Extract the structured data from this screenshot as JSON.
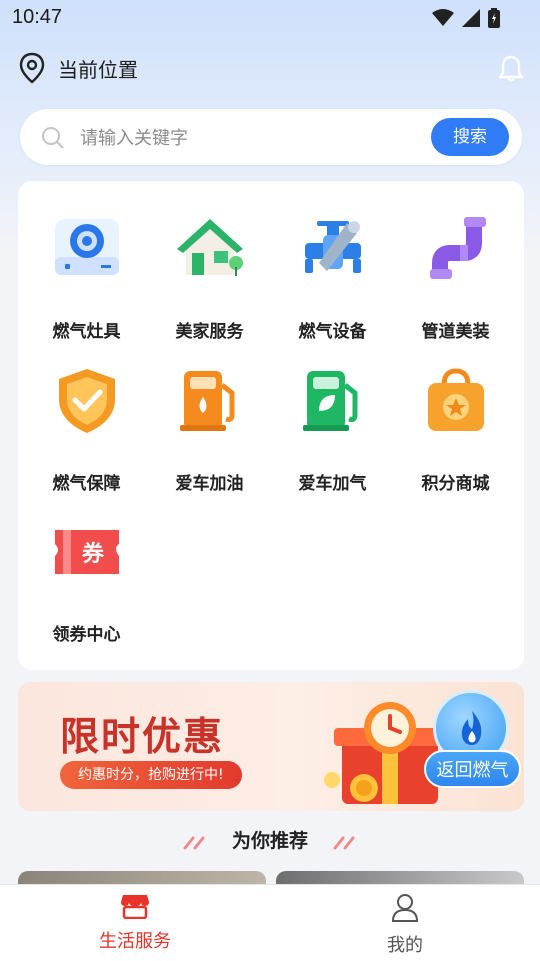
{
  "status_bar": {
    "time": "10:47"
  },
  "header": {
    "location_label": "当前位置"
  },
  "search": {
    "placeholder": "请输入关键字",
    "button_label": "搜索"
  },
  "services": [
    {
      "label": "燃气灶具",
      "icon": "gas-stove-icon"
    },
    {
      "label": "美家服务",
      "icon": "house-icon"
    },
    {
      "label": "燃气设备",
      "icon": "gas-valve-tools-icon"
    },
    {
      "label": "管道美装",
      "icon": "pipe-icon"
    },
    {
      "label": "燃气保障",
      "icon": "shield-check-icon"
    },
    {
      "label": "爱车加油",
      "icon": "fuel-pump-icon"
    },
    {
      "label": "爱车加气",
      "icon": "gas-pump-leaf-icon"
    },
    {
      "label": "积分商城",
      "icon": "shopping-bag-star-icon"
    },
    {
      "label": "领券中心",
      "icon": "coupon-icon"
    }
  ],
  "coupon_icon_text": "券",
  "banner": {
    "title": "限时优惠",
    "subtitle": "约惠时分，抢购进行中!"
  },
  "floating_button": {
    "label": "返回燃气"
  },
  "recommend": {
    "title": "为你推荐"
  },
  "tabbar": {
    "tabs": [
      {
        "label": "生活服务",
        "active": true
      },
      {
        "label": "我的",
        "active": false
      }
    ]
  },
  "colors": {
    "accent": "#2f7cf6",
    "active_tab": "#e8322a",
    "banner_title": "#c93228"
  }
}
